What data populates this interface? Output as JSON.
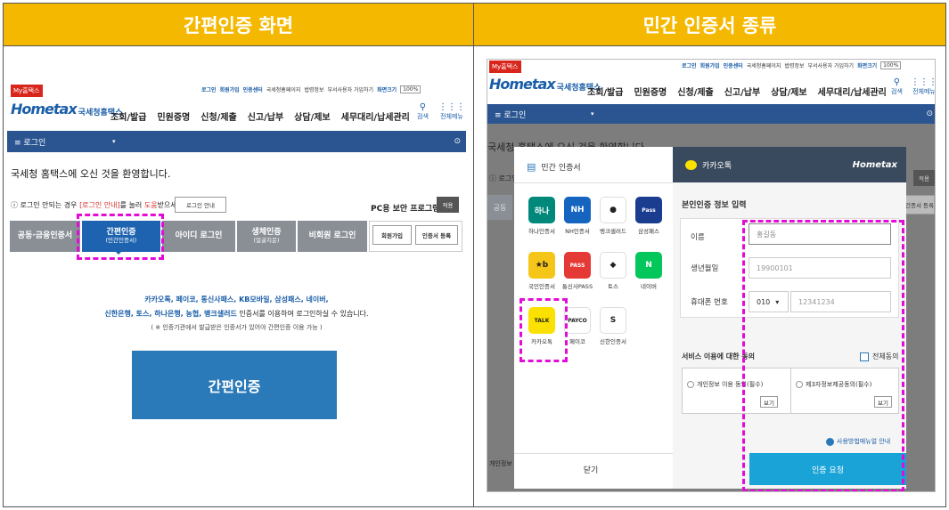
{
  "headers": {
    "left": "간편인증 화면",
    "right": "민간 인증서 종류"
  },
  "left_screen": {
    "my_hometax": "My홈택스",
    "top_links": [
      "로그인",
      "회원가입",
      "인증센터",
      "국세청홈페이지",
      "법령정보",
      "부서사용자 가입하기",
      "화면크기"
    ],
    "zoom": "100%",
    "logo_main": "Hometax",
    "logo_sub": "국세청홈택스",
    "nav": [
      "조회/발급",
      "민원증명",
      "신청/제출",
      "신고/납부",
      "상담/제보",
      "세무대리/납세관리"
    ],
    "search": "검색",
    "all_menu": "전체메뉴",
    "login_bar": "≡ 로그인",
    "welcome": "국세청 홈택스에 오신 것을 환영합니다.",
    "notice_prefix": "로그인 안되는 경우",
    "notice_link1": "[로그인 안내]",
    "notice_mid": "를 눌러",
    "notice_link2": "도움",
    "notice_suffix": "받으세요.",
    "login_guide_btn": "로그인 안내",
    "pc_security": "PC용 보안 프로그램",
    "apply_btn": "적용",
    "tabs": [
      {
        "label": "공동·금융인증서",
        "sub": ""
      },
      {
        "label": "간편인증",
        "sub": "(민간인증서)"
      },
      {
        "label": "아이디 로그인",
        "sub": ""
      },
      {
        "label": "생체인증",
        "sub": "(얼굴지문)"
      },
      {
        "label": "비회원 로그인",
        "sub": ""
      }
    ],
    "signup_btn": "회원가입",
    "cert_register_btn": "인증서 등록",
    "desc_line1": "카카오톡, 페이코, 통신사패스, KB모바일, 삼성패스, 네이버,",
    "desc_line2_blue": "신한은행, 토스, 하나은행, 농협, 뱅크샐러드",
    "desc_line2_rest": " 인증서를 이용하여 로그인하실 수 있습니다.",
    "desc_note": "( ※ 인증기관에서 발급받은 인증서가 있어야 간편인증 이용 가능 )",
    "simple_auth_btn": "간편인증"
  },
  "right_screen": {
    "my_hometax": "My홈택스",
    "top_links": [
      "로그인",
      "회원가입",
      "인증센터",
      "국세청홈페이지",
      "법령정보",
      "부서사용자 가입하기",
      "화면크기"
    ],
    "zoom": "100%",
    "logo_main": "Hometax",
    "logo_sub": "국세청홈택스",
    "nav": [
      "조회/발급",
      "민원증명",
      "신청/제출",
      "신고/납부",
      "상담/제보",
      "세무대리/납세관리"
    ],
    "search": "검색",
    "all_menu": "전체메뉴",
    "login_bar": "≡ 로그인",
    "welcome_partial": "국세청 홈택스에 오신 것을 환영합니다.",
    "bg_partial_login": "로그인",
    "bg_partial_tab": "공동",
    "bg_apply": "적용",
    "bg_cert_register": "인증서 등록",
    "bg_footer": "개인정보",
    "modal": {
      "left_title": "민간 인증서",
      "apps": [
        {
          "icon": "hana",
          "label": "하나인증서",
          "color": "#00897b",
          "glyph": "하나"
        },
        {
          "icon": "nh",
          "label": "NH인증서",
          "color": "#1565c0",
          "glyph": "NH"
        },
        {
          "icon": "banksalad",
          "label": "뱅크샐러드",
          "color": "#ffffff",
          "glyph": "●"
        },
        {
          "icon": "samsungpass",
          "label": "삼성패스",
          "color": "#1a3d8f",
          "glyph": "Pass"
        },
        {
          "icon": "kb",
          "label": "국민인증서",
          "color": "#f5c518",
          "glyph": "★b"
        },
        {
          "icon": "pass",
          "label": "통신사PASS",
          "color": "#e53935",
          "glyph": "PASS"
        },
        {
          "icon": "toss",
          "label": "토스",
          "color": "#ffffff",
          "glyph": "◆"
        },
        {
          "icon": "naver",
          "label": "네이버",
          "color": "#03c75a",
          "glyph": "N"
        },
        {
          "icon": "kakao",
          "label": "카카오톡",
          "color": "#fae100",
          "glyph": "TALK"
        },
        {
          "icon": "payco",
          "label": "페이코",
          "color": "#ffffff",
          "glyph": "PAYCO"
        },
        {
          "icon": "shinhan",
          "label": "신한인증서",
          "color": "#ffffff",
          "glyph": "S"
        }
      ],
      "right_title": "카카오톡",
      "right_logo": "Hometax",
      "section_title": "본인인증 정보 입력",
      "name_label": "이름",
      "name_placeholder": "홍길동",
      "birth_label": "생년월일",
      "birth_placeholder": "19900101",
      "phone_label": "휴대폰 번호",
      "phone_prefix": "010",
      "phone_placeholder": "12341234",
      "agree_title": "서비스 이용에 대한 동의",
      "agree_all": "전체동의",
      "agree1": "개인정보 이용 동의(필수)",
      "agree2": "제3자정보제공동의(필수)",
      "view_btn": "보기",
      "guide_link": "사용방법매뉴얼 안내",
      "close_btn": "닫기",
      "request_btn": "인증 요청"
    }
  },
  "colors": {
    "header_bg": "#f5b800",
    "navy": "#2a5591",
    "tab_gray": "#8a8f96",
    "tab_active": "#1e63b0",
    "auth_button": "#2a79b8",
    "highlight": "#e40bd8",
    "kakao_header": "#3a4a5e",
    "request_bg": "#1aa3d6"
  }
}
